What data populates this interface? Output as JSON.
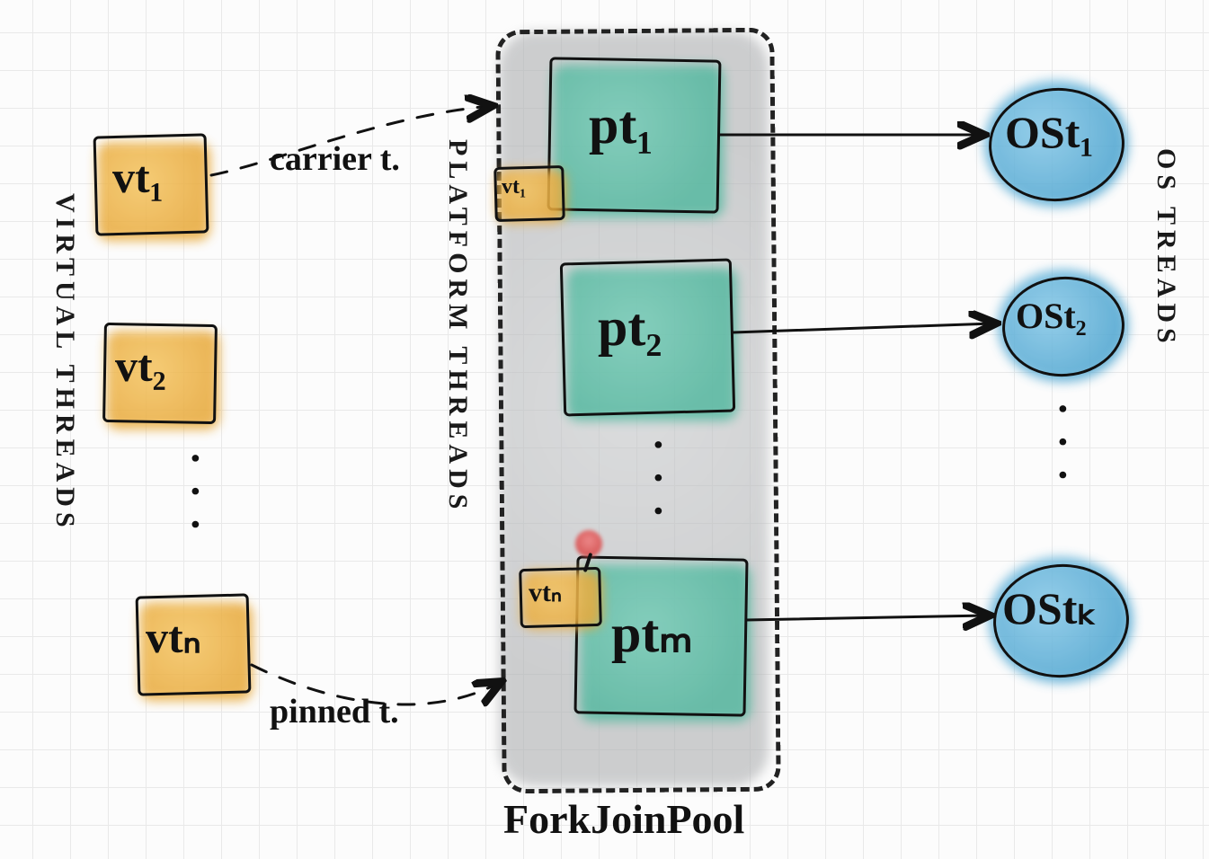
{
  "columns": {
    "virtual_threads_label": "VIRTUAL THREADS",
    "platform_threads_label": "PLATFORM THREADS",
    "os_threads_label": "OS TREADS"
  },
  "pool_label": "ForkJoinPool",
  "connectors": {
    "carrier": "carrier t.",
    "pinned": "pinned t."
  },
  "virtual_threads": [
    {
      "id": "vt1",
      "label": "vt₁"
    },
    {
      "id": "vt2",
      "label": "vt₂"
    },
    {
      "id": "vtn",
      "label": "vtₙ"
    }
  ],
  "platform_threads": [
    {
      "id": "pt1",
      "label": "pt₁",
      "mounted_vt": "vt₁"
    },
    {
      "id": "pt2",
      "label": "pt₂",
      "mounted_vt": null
    },
    {
      "id": "ptm",
      "label": "ptₘ",
      "mounted_vt": "vtₙ",
      "pinned": true
    }
  ],
  "os_threads": [
    {
      "id": "ost1",
      "label": "OSt₁"
    },
    {
      "id": "ost2",
      "label": "OSt₂"
    },
    {
      "id": "ostk",
      "label": "OStₖ"
    }
  ],
  "colors": {
    "virtual": "#e8a93a",
    "platform": "#57b9a1",
    "os": "#4aa3cf",
    "pool_ghost": "#adafb1",
    "pin": "#d84545",
    "ink": "#111111"
  }
}
